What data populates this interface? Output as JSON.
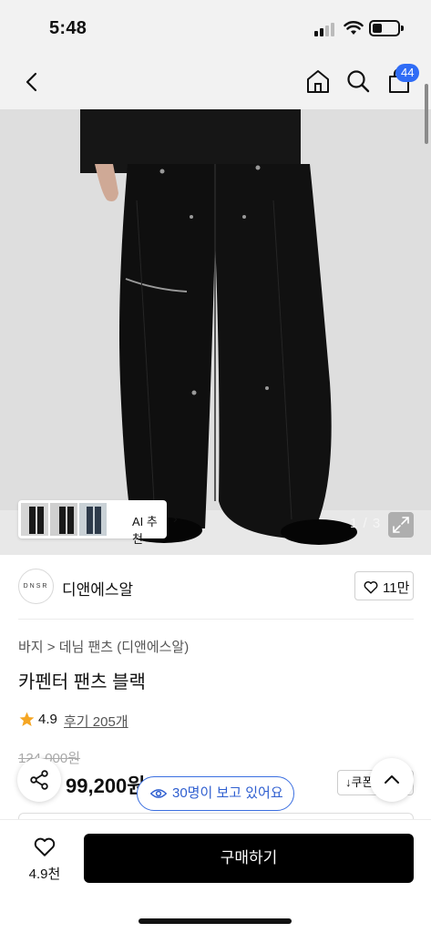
{
  "status_bar": {
    "time": "5:48",
    "icons": [
      "cellular-signal-icon",
      "wifi-icon",
      "battery-icon"
    ]
  },
  "header": {
    "icons": [
      "back-arrow-icon",
      "home-icon",
      "search-icon",
      "shopping-bag-icon"
    ],
    "cart_badge": "44",
    "accent_color": "#2f6cf6"
  },
  "gallery": {
    "thumbnail_label": "AI 추천",
    "page_indicator": "1 / 3",
    "expand_icon": "expand-icon"
  },
  "brand": {
    "logo_text": "DNSR",
    "name": "디앤에스알",
    "like_count": "11만"
  },
  "product": {
    "breadcrumb": "바지 > 데님 팬츠 (디앤에스알)",
    "title": "카펜터 팬츠 블랙",
    "rating": "4.9",
    "reviews": "후기 205개",
    "original_price": "124,000원",
    "sale_price": "99,200원",
    "coupon_label": "쿠폰"
  },
  "floating": {
    "viewers_text": "30명이 보고 있어요",
    "viewers_color": "#3b6fe0"
  },
  "bottom_bar": {
    "wish_count": "4.9천",
    "buy_label": "구매하기"
  }
}
